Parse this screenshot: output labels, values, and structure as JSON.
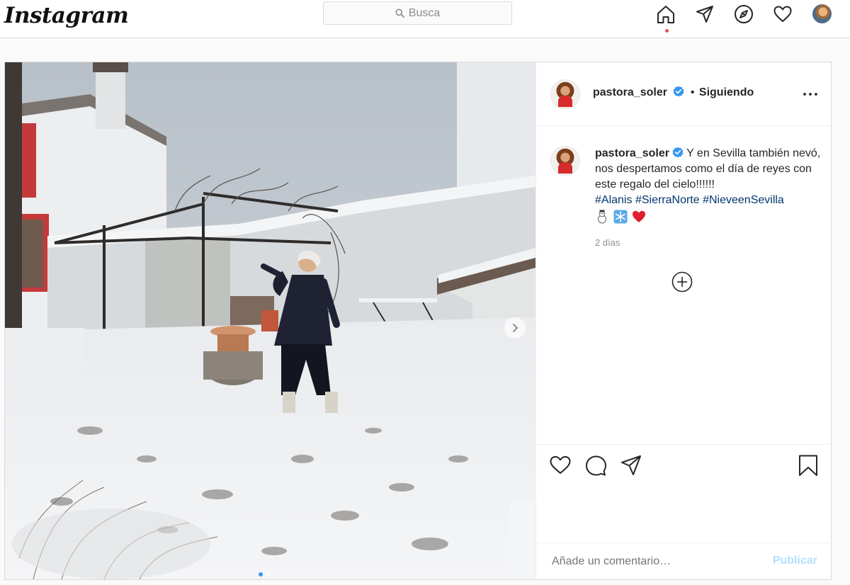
{
  "nav": {
    "logo": "Instagram",
    "search_placeholder": "Busca",
    "icons": [
      "home-icon",
      "direct-icon",
      "explore-icon",
      "activity-heart-icon",
      "profile-avatar"
    ],
    "active_dot_color": "#ed4956"
  },
  "post": {
    "username": "pastora_soler",
    "follow_separator": "•",
    "follow_status": "Siguiendo",
    "caption_user": "pastora_soler",
    "caption_text": "Y en Sevilla también nevó, nos despertamos como el día de reyes con este regalo del cielo!!!!!!",
    "hashtags": [
      "#Alanis",
      "#SierraNorte",
      "#NieveenSevilla"
    ],
    "emojis": [
      "snowman",
      "snowflake",
      "red-heart"
    ],
    "time": "2 días",
    "comment_placeholder": "Añade un comentario…",
    "publish_label": "Publicar",
    "carousel_dots": 2,
    "carousel_active": 0
  },
  "colors": {
    "verified": "#3897f0",
    "hashtag": "#00376b",
    "publish_disabled": "#b2dffc",
    "border": "#dbdbdb"
  }
}
